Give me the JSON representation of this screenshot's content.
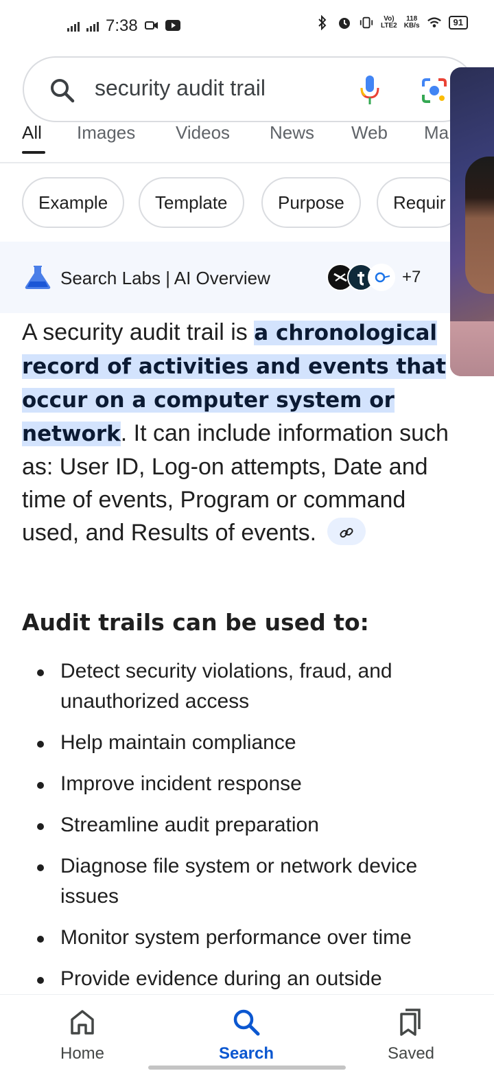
{
  "status_bar": {
    "time": "7:38",
    "network_badge_top": "Vo)",
    "network_badge_bottom": "LTE2",
    "speed_top": "118",
    "speed_bottom": "KB/s",
    "battery": "91"
  },
  "search": {
    "query": "security audit trail",
    "icons": [
      "search-icon",
      "mic-icon",
      "google-lens-icon"
    ]
  },
  "tabs": [
    {
      "label": "All",
      "active": true
    },
    {
      "label": "Images"
    },
    {
      "label": "Videos"
    },
    {
      "label": "News"
    },
    {
      "label": "Web"
    },
    {
      "label": "Ma"
    }
  ],
  "chips": [
    "Example",
    "Template",
    "Purpose",
    "Requir"
  ],
  "overview": {
    "header": "Search Labs | AI Overview",
    "sources_more": "+7",
    "intro_before": "A security audit trail is ",
    "intro_highlight": "a chronological record of activities and events that occur on a computer system or network",
    "intro_after": ". It can include information such as: User ID, Log-on attempts, Date and time of events, Program or command used, and Results of events.",
    "section_title": "Audit trails can be used to:",
    "bullets": [
      "Detect security violations, fraud, and unauthorized access",
      "Help maintain compliance",
      "Improve incident response",
      "Streamline audit preparation",
      "Diagnose file system or network device issues",
      "Monitor system performance over time",
      "Provide evidence during an outside"
    ]
  },
  "bottom_nav": {
    "home": "Home",
    "search": "Search",
    "saved": "Saved",
    "active": "Search"
  },
  "colors": {
    "accent": "#0b57d0",
    "highlight": "#d3e3fd",
    "labs_bg": "#f4f7fd"
  }
}
